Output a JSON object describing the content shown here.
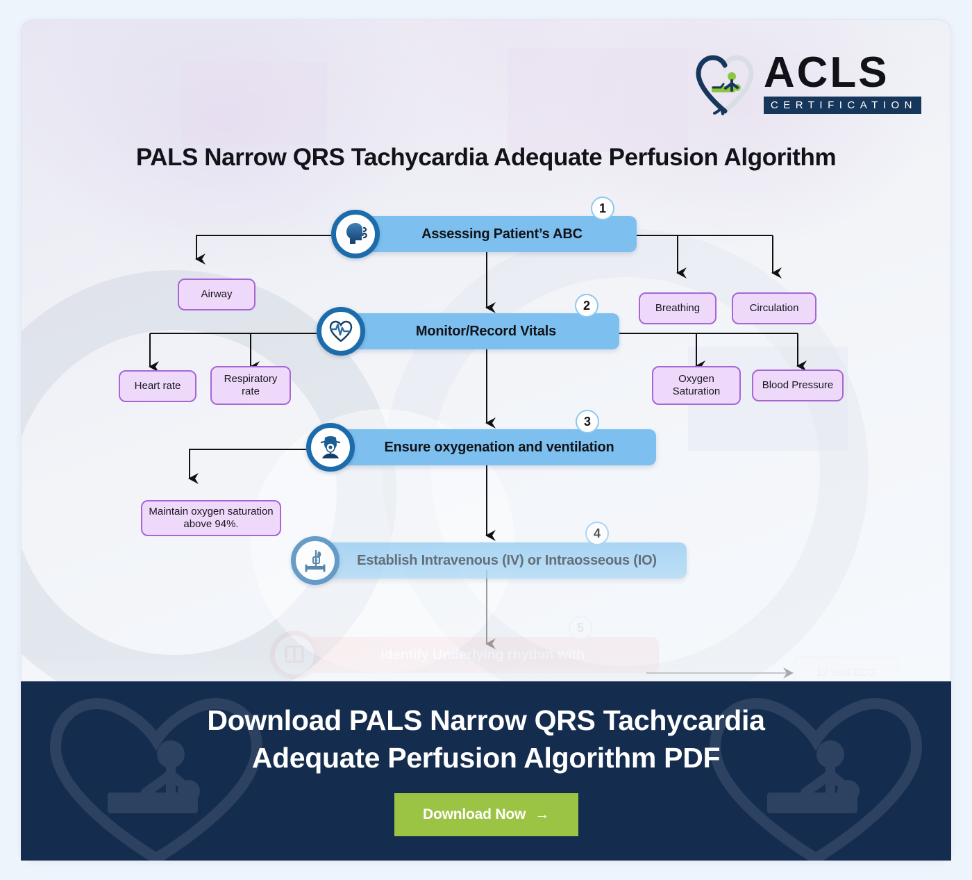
{
  "brand": {
    "logo_name": "ACLS",
    "logo_sub": "CERTIFICATION",
    "logo_icon": "heart-cpr-icon"
  },
  "header": {
    "title": "PALS Narrow QRS Tachycardia Adequate Perfusion Algorithm"
  },
  "colors": {
    "step_bar": "#7dc0f0",
    "icon_ring": "#1c6cab",
    "sub_border": "#a865d6",
    "sub_fill": "#efd9fb",
    "cta_bg": "#142c4e",
    "cta_button": "#9cc444",
    "page_bg": "#eef4fc"
  },
  "flow": {
    "steps": [
      {
        "number": "1",
        "label": "Assessing Patient’s ABC",
        "icon": "head-breathing-icon",
        "children": [
          {
            "label": "Airway"
          },
          {
            "label": "Breathing"
          },
          {
            "label": "Circulation"
          }
        ]
      },
      {
        "number": "2",
        "label": "Monitor/Record Vitals",
        "icon": "heart-ecg-icon",
        "children": [
          {
            "label": "Heart rate"
          },
          {
            "label": "Respiratory rate"
          },
          {
            "label": "Oxygen Saturation"
          },
          {
            "label": "Blood Pressure"
          }
        ]
      },
      {
        "number": "3",
        "label": "Ensure oxygenation and ventilation",
        "icon": "oxygen-mask-icon",
        "children": [
          {
            "label": "Maintain oxygen saturation above 94%."
          }
        ]
      },
      {
        "number": "4",
        "label": "Establish Intravenous (IV) or Intraosseous (IO)",
        "icon": "iv-drip-icon",
        "children": []
      },
      {
        "number": "5",
        "label": "Identify Underlying rhythm with",
        "icon": "ecg-monitor-icon",
        "children": [
          {
            "label": "12 lead ECG"
          }
        ]
      }
    ]
  },
  "cta": {
    "heading_line1": "Download PALS Narrow QRS Tachycardia",
    "heading_line2": "Adequate Perfusion Algorithm PDF",
    "button_label": "Download Now",
    "button_arrow": "→"
  }
}
